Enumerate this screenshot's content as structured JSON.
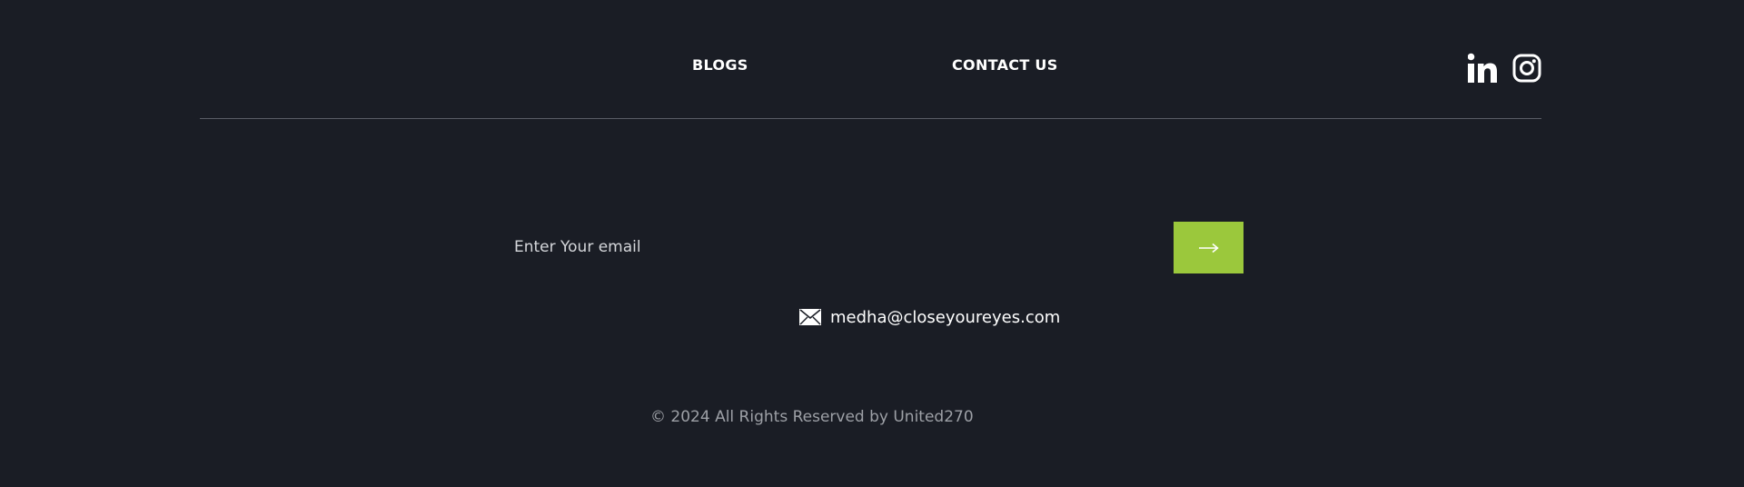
{
  "nav": {
    "items": [
      {
        "label": "BLOGS"
      },
      {
        "label": "CONTACT US"
      }
    ]
  },
  "social": {
    "linkedin_icon": "linkedin-icon",
    "instagram_icon": "instagram-icon"
  },
  "newsletter": {
    "placeholder": "Enter Your email",
    "value": "",
    "submit_icon": "arrow-right-icon",
    "submit_color": "#9bc83c"
  },
  "contact": {
    "icon": "mail-icon",
    "email": "medha@closeyoureyes.com"
  },
  "footer": {
    "copyright": "© 2024 All Rights Reserved by United270"
  },
  "colors": {
    "background": "#1a1d25",
    "accent": "#9bc83c",
    "text": "#ffffff",
    "muted_text": "#9da0a6",
    "divider": "#5a5d66"
  }
}
